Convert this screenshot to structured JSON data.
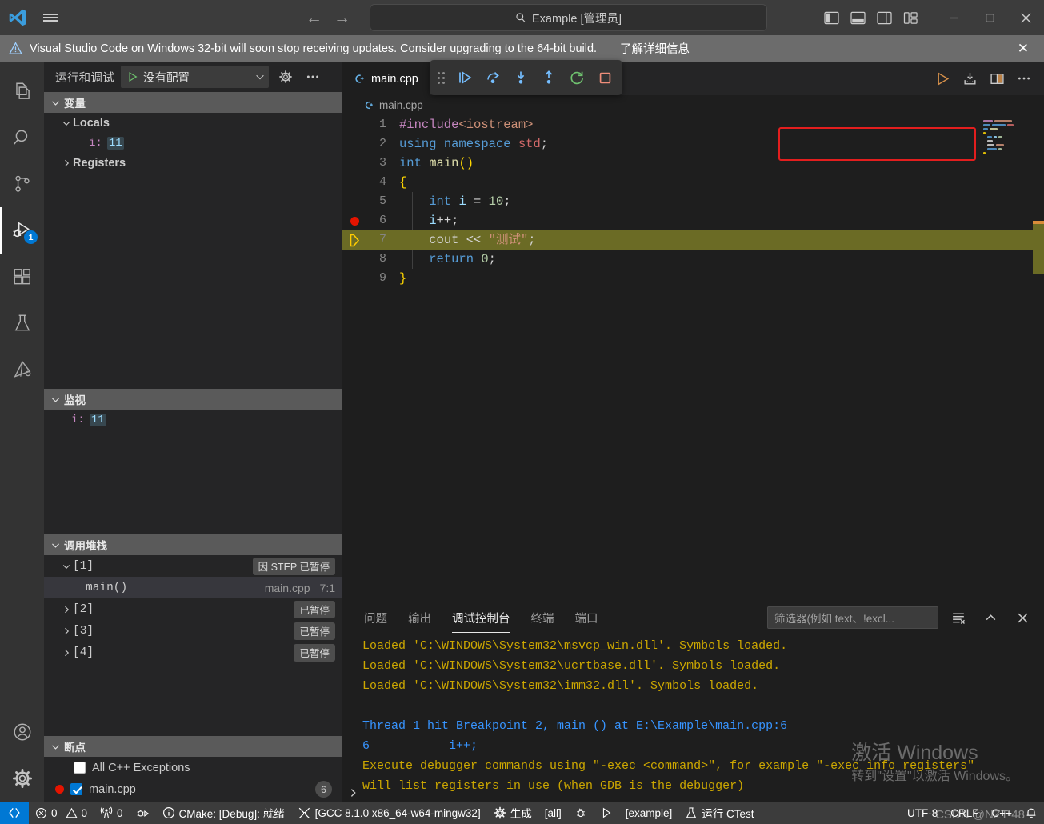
{
  "titlebar": {
    "search_value": "Example [管理员]",
    "search_icon": "search-icon",
    "back_icon": "←",
    "forward_icon": "→",
    "minimize": "—",
    "maximize": "□",
    "close": "✕"
  },
  "notification": {
    "text": "Visual Studio Code on Windows 32-bit will soon stop receiving updates. Consider upgrading to the 64-bit build.",
    "link": "了解详细信息",
    "close": "✕"
  },
  "activitybar": {
    "items": [
      {
        "name": "explorer",
        "icon": "files-icon"
      },
      {
        "name": "search",
        "icon": "search-icon"
      },
      {
        "name": "source-control",
        "icon": "source-control-icon"
      },
      {
        "name": "run-and-debug",
        "icon": "run-debug-icon",
        "badge": "1",
        "active": true
      },
      {
        "name": "extensions",
        "icon": "extensions-icon"
      },
      {
        "name": "testing",
        "icon": "beaker-icon"
      },
      {
        "name": "cmake",
        "icon": "cmake-icon"
      }
    ],
    "bottom": [
      {
        "name": "accounts",
        "icon": "account-icon"
      },
      {
        "name": "settings",
        "icon": "gear-icon"
      }
    ]
  },
  "sidebar": {
    "title": "运行和调试",
    "config_label": "没有配置",
    "config_play_icon": "play-icon",
    "config_chevron": "chevron-down-icon",
    "gear_icon": "gear-icon",
    "more_icon": "more-icon",
    "sections": {
      "variables": {
        "title": "变量",
        "chevron": "chevron-down-icon",
        "rows": [
          {
            "type": "scope",
            "chevron": "chevron-down-icon",
            "label": "Locals"
          },
          {
            "type": "var",
            "name": "i:",
            "value": "11"
          },
          {
            "type": "scope",
            "chevron": "chevron-right-icon",
            "label": "Registers"
          }
        ]
      },
      "watch": {
        "title": "监视",
        "chevron": "chevron-down-icon",
        "rows": [
          {
            "name": "i:",
            "value": "11"
          }
        ]
      },
      "callstack": {
        "title": "调用堆栈",
        "chevron": "chevron-down-icon",
        "rows": [
          {
            "chevron": "chevron-down-icon",
            "label": "[1]",
            "pill": "因 STEP 已暂停",
            "selected": false,
            "indent": 0
          },
          {
            "chevron": "",
            "label": "main()",
            "file": "main.cpp",
            "pos": "7:1",
            "selected": true,
            "indent": 1
          },
          {
            "chevron": "chevron-right-icon",
            "label": "[2]",
            "pill": "已暂停",
            "selected": false,
            "indent": 0
          },
          {
            "chevron": "chevron-right-icon",
            "label": "[3]",
            "pill": "已暂停",
            "selected": false,
            "indent": 0
          },
          {
            "chevron": "chevron-right-icon",
            "label": "[4]",
            "pill": "已暂停",
            "selected": false,
            "indent": 0
          }
        ]
      },
      "breakpoints": {
        "title": "断点",
        "chevron": "chevron-down-icon",
        "rows": [
          {
            "label": "All C++ Exceptions",
            "checked": false,
            "dot": false,
            "count": ""
          },
          {
            "label": "main.cpp",
            "checked": true,
            "dot": true,
            "count": "6"
          }
        ]
      }
    }
  },
  "editor": {
    "tab": {
      "label": "main.cpp",
      "icon": "cpp-file-icon"
    },
    "breadcrumb": {
      "label": "main.cpp",
      "icon": "cpp-file-icon"
    },
    "actions": [
      {
        "name": "run-button",
        "icon": "play-icon"
      },
      {
        "name": "debug-c-cpp-file-button",
        "icon": "debug-download-icon"
      },
      {
        "name": "split-editor-button",
        "icon": "split-editor-icon"
      },
      {
        "name": "more-actions-button",
        "icon": "more-icon"
      }
    ],
    "debug_toolbar": {
      "grip": "grip-icon",
      "buttons": [
        {
          "name": "continue",
          "icon": "continue-icon"
        },
        {
          "name": "step-over",
          "icon": "step-over-icon"
        },
        {
          "name": "step-into",
          "icon": "step-into-icon"
        },
        {
          "name": "step-out",
          "icon": "step-out-icon"
        },
        {
          "name": "restart",
          "icon": "restart-icon"
        },
        {
          "name": "stop",
          "icon": "stop-icon"
        }
      ]
    },
    "lines": [
      {
        "n": "1",
        "breakpoint": false,
        "pointer": false,
        "highlight": false,
        "tokens": [
          {
            "t": "#include",
            "c": "c-pre"
          },
          {
            "t": "<iostream>",
            "c": "c-inc"
          }
        ]
      },
      {
        "n": "2",
        "breakpoint": false,
        "pointer": false,
        "highlight": false,
        "tokens": [
          {
            "t": "using",
            "c": "c-kw"
          },
          {
            "t": " ",
            "c": "c-plain"
          },
          {
            "t": "namespace",
            "c": "c-kw"
          },
          {
            "t": " ",
            "c": "c-plain"
          },
          {
            "t": "std",
            "c": "c-std"
          },
          {
            "t": ";",
            "c": "c-plain"
          }
        ]
      },
      {
        "n": "3",
        "breakpoint": false,
        "pointer": false,
        "highlight": false,
        "tokens": [
          {
            "t": "int",
            "c": "c-type"
          },
          {
            "t": " ",
            "c": "c-plain"
          },
          {
            "t": "main",
            "c": "c-fn"
          },
          {
            "t": "()",
            "c": "c-brace"
          }
        ]
      },
      {
        "n": "4",
        "breakpoint": false,
        "pointer": false,
        "highlight": false,
        "tokens": [
          {
            "t": "{",
            "c": "c-brace"
          }
        ]
      },
      {
        "n": "5",
        "breakpoint": false,
        "pointer": false,
        "highlight": false,
        "tokens": [
          {
            "t": "    ",
            "c": "c-plain"
          },
          {
            "t": "int",
            "c": "c-type"
          },
          {
            "t": " ",
            "c": "c-plain"
          },
          {
            "t": "i",
            "c": "c-var"
          },
          {
            "t": " = ",
            "c": "c-plain"
          },
          {
            "t": "10",
            "c": "c-num"
          },
          {
            "t": ";",
            "c": "c-plain"
          }
        ]
      },
      {
        "n": "6",
        "breakpoint": true,
        "pointer": false,
        "highlight": false,
        "tokens": [
          {
            "t": "    ",
            "c": "c-plain"
          },
          {
            "t": "i",
            "c": "c-var"
          },
          {
            "t": "++;",
            "c": "c-plain"
          }
        ]
      },
      {
        "n": "7",
        "breakpoint": false,
        "pointer": true,
        "highlight": true,
        "tokens": [
          {
            "t": "    ",
            "c": "c-plain"
          },
          {
            "t": "cout",
            "c": "c-plain"
          },
          {
            "t": " ",
            "c": "c-plain"
          },
          {
            "t": "<<",
            "c": "c-op"
          },
          {
            "t": " ",
            "c": "c-plain"
          },
          {
            "t": "\"测试\"",
            "c": "c-str"
          },
          {
            "t": ";",
            "c": "c-plain"
          }
        ]
      },
      {
        "n": "8",
        "breakpoint": false,
        "pointer": false,
        "highlight": false,
        "tokens": [
          {
            "t": "    ",
            "c": "c-plain"
          },
          {
            "t": "return",
            "c": "c-kw"
          },
          {
            "t": " ",
            "c": "c-plain"
          },
          {
            "t": "0",
            "c": "c-num"
          },
          {
            "t": ";",
            "c": "c-plain"
          }
        ]
      },
      {
        "n": "9",
        "breakpoint": false,
        "pointer": false,
        "highlight": false,
        "tokens": [
          {
            "t": "}",
            "c": "c-brace"
          }
        ]
      }
    ]
  },
  "panel": {
    "tabs": [
      {
        "label": "问题",
        "active": false
      },
      {
        "label": "输出",
        "active": false
      },
      {
        "label": "调试控制台",
        "active": true
      },
      {
        "label": "终端",
        "active": false
      },
      {
        "label": "端口",
        "active": false
      }
    ],
    "filter_placeholder": "筛选器(例如 text、!excl...",
    "actions": [
      {
        "name": "clear-console-button",
        "icon": "clear-icon"
      },
      {
        "name": "collapse-panel-button",
        "icon": "chevron-up-icon"
      },
      {
        "name": "close-panel-button",
        "icon": "close-icon"
      }
    ],
    "expand_icon": "chevron-right-icon",
    "log": [
      {
        "text": "Loaded 'C:\\WINDOWS\\System32\\msvcp_win.dll'. Symbols loaded.",
        "color": "log-yellow"
      },
      {
        "text": "Loaded 'C:\\WINDOWS\\System32\\ucrtbase.dll'. Symbols loaded.",
        "color": "log-yellow"
      },
      {
        "text": "Loaded 'C:\\WINDOWS\\System32\\imm32.dll'. Symbols loaded.",
        "color": "log-yellow"
      },
      {
        "text": " ",
        "color": "log-yellow"
      },
      {
        "text": "Thread 1 hit Breakpoint 2, main () at E:\\Example\\main.cpp:6",
        "color": "log-blue"
      },
      {
        "text": "6           i++;",
        "color": "log-blue"
      },
      {
        "text": "Execute debugger commands using \"-exec <command>\", for example \"-exec info registers\"",
        "color": "log-yellow"
      },
      {
        "text": "will list registers in use (when GDB is the debugger)",
        "color": "log-yellow"
      }
    ]
  },
  "statusbar": {
    "remote_icon": "remote-icon",
    "left": [
      {
        "name": "problems",
        "icon": "error-icon",
        "label": "0",
        "icon2": "warning-icon",
        "label2": "0"
      },
      {
        "name": "radio-tower",
        "icon": "radio-tower-icon",
        "label": "0"
      },
      {
        "name": "debug-console-status",
        "icon": "debug-alt-icon",
        "label": ""
      },
      {
        "name": "cmake-status",
        "icon": "info-icon",
        "label": "CMake: [Debug]: 就绪"
      },
      {
        "name": "kit-status",
        "icon": "tools-icon",
        "label": "[GCC 8.1.0 x86_64-w64-mingw32]"
      },
      {
        "name": "build-status",
        "icon": "gear-icon",
        "label": "生成"
      },
      {
        "name": "build-target",
        "icon": "",
        "label": "[all]"
      },
      {
        "name": "debug-target-icon",
        "icon": "bug-icon",
        "label": ""
      },
      {
        "name": "launch-run",
        "icon": "play-icon",
        "label": ""
      },
      {
        "name": "launch-target",
        "icon": "",
        "label": "[example]"
      },
      {
        "name": "ctest",
        "icon": "beaker-icon",
        "label": "运行 CTest"
      }
    ],
    "right": [
      {
        "name": "encoding",
        "label": "UTF-8"
      },
      {
        "name": "eol",
        "label": "CRLF"
      },
      {
        "name": "language-mode",
        "label": "C++"
      },
      {
        "name": "notifications",
        "icon": "bell-icon",
        "label": ""
      }
    ]
  },
  "watermarks": {
    "activate_line1": "激活 Windows",
    "activate_line2": "转到\"设置\"以激活 Windows。",
    "csdn": "CSDN @NZT-48"
  }
}
